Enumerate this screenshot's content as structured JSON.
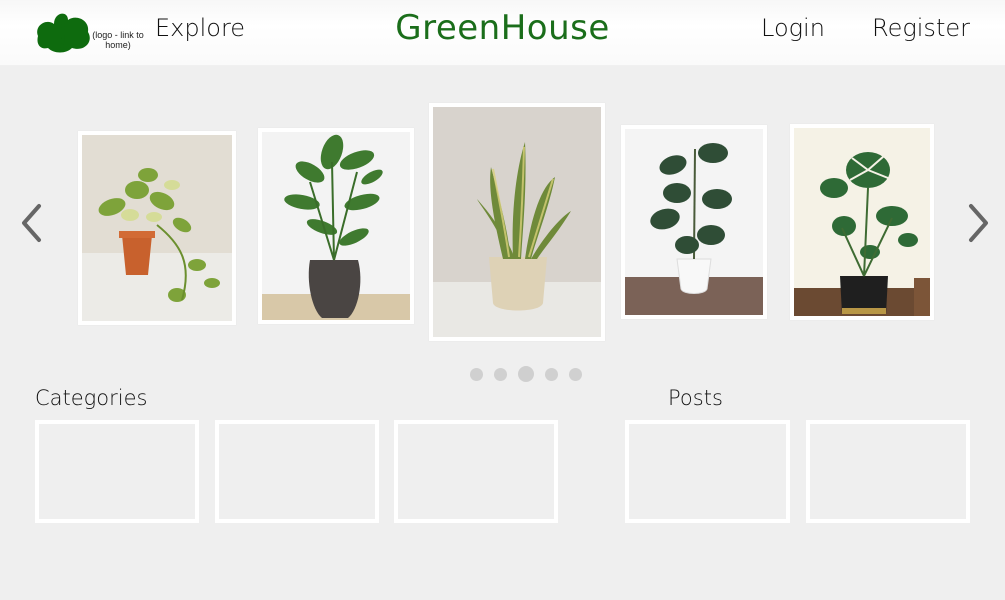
{
  "header": {
    "logo_note": "(logo - link to home)",
    "explore_label": "Explore",
    "brand_title": "GreenHouse",
    "login_label": "Login",
    "register_label": "Register",
    "brand_color": "#1b6e1b",
    "logo_color": "#0e6b0e"
  },
  "carousel": {
    "prev_icon": "chevron-left-icon",
    "next_icon": "chevron-right-icon",
    "slides": [
      {
        "name": "pothos-plant-image",
        "pot": "terracotta"
      },
      {
        "name": "bird-of-paradise-plant-image",
        "pot": "dark-ribbed"
      },
      {
        "name": "snake-plant-image",
        "pot": "beige"
      },
      {
        "name": "rubber-plant-image",
        "pot": "white"
      },
      {
        "name": "monstera-plant-image",
        "pot": "black-gold"
      }
    ],
    "dot_count": 5,
    "active_dot": 3
  },
  "categories": {
    "title": "Categories",
    "tiles": 3
  },
  "posts": {
    "title": "Posts",
    "tiles": 2
  }
}
